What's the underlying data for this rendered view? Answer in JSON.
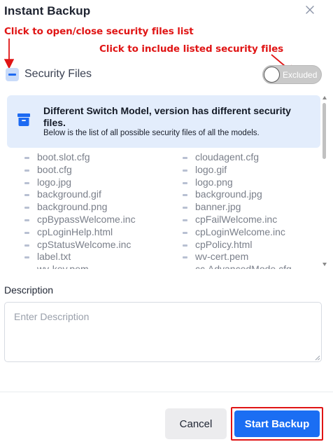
{
  "dialog": {
    "title": "Instant Backup",
    "close_icon": "close-icon"
  },
  "annotations": {
    "open_close": "Click to open/close security files list",
    "include": "Click to include listed security files",
    "color": "#e01515"
  },
  "security_files": {
    "label": "Security Files",
    "collapse_icon": "minus-icon",
    "toggle": {
      "label": "Excluded",
      "state": "off"
    }
  },
  "info": {
    "icon": "archive-box-icon",
    "title": "Different Switch Model, version has different security files.",
    "subtitle": "Below is the list of all possible security files of all the models."
  },
  "files": {
    "left": [
      "boot.slot.cfg",
      "boot.cfg",
      "logo.jpg",
      "background.gif",
      "background.png",
      "cpBypassWelcome.inc",
      "cpLoginHelp.html",
      "cpStatusWelcome.inc",
      "label.txt",
      "wv-key.pem"
    ],
    "right": [
      "cloudagent.cfg",
      "logo.gif",
      "logo.png",
      "background.jpg",
      "banner.jpg",
      "cpFailWelcome.inc",
      "cpLoginWelcome.inc",
      "cpPolicy.html",
      "wv-cert.pem",
      "cc.AdvancedMode.cfg"
    ]
  },
  "description": {
    "label": "Description",
    "placeholder": "Enter Description",
    "value": ""
  },
  "buttons": {
    "cancel": "Cancel",
    "start": "Start Backup"
  },
  "colors": {
    "accent": "#1b6ef3",
    "info_bg": "#e3edfc",
    "toggle_off": "#c9c9c9"
  }
}
